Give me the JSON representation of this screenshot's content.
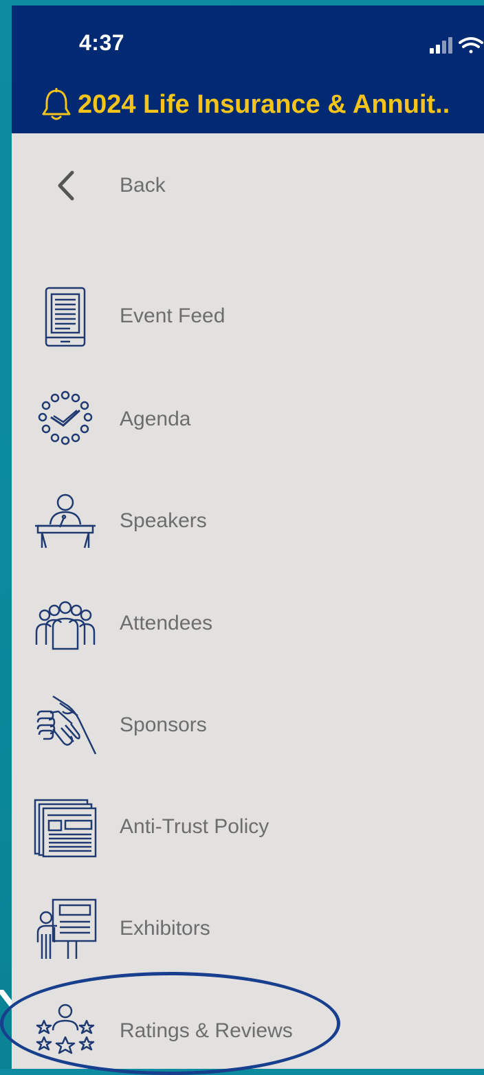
{
  "status_bar": {
    "time": "4:37",
    "icons": [
      "signal-icon",
      "wifi-icon"
    ]
  },
  "header": {
    "icon": "bell-icon",
    "title": "2024 Life Insurance & Annuit.."
  },
  "back": {
    "icon": "chevron-left-icon",
    "label": "Back"
  },
  "menu": {
    "items": [
      {
        "label": "Event Feed",
        "icon": "tablet-feed-icon"
      },
      {
        "label": "Agenda",
        "icon": "clock-agenda-icon"
      },
      {
        "label": "Speakers",
        "icon": "podium-speaker-icon"
      },
      {
        "label": "Attendees",
        "icon": "people-group-icon"
      },
      {
        "label": "Sponsors",
        "icon": "handshake-icon"
      },
      {
        "label": "Anti-Trust Policy",
        "icon": "newspaper-icon"
      },
      {
        "label": "Exhibitors",
        "icon": "presenter-board-icon"
      },
      {
        "label": "Ratings & Reviews",
        "icon": "stars-rating-icon"
      }
    ]
  },
  "colors": {
    "header_bg": "#012a72",
    "title": "#f5c41a",
    "menu_bg": "#e3e1df",
    "label": "#6d6d6d",
    "icon_stroke": "#1f3a72",
    "highlight": "#183e8e"
  }
}
